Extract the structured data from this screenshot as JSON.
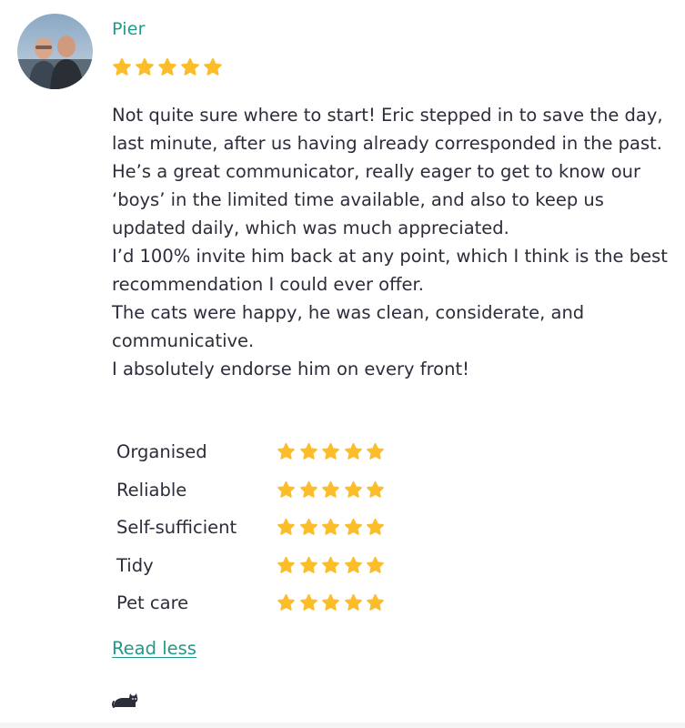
{
  "reviewer": {
    "name": "Pier",
    "overall_rating": 5,
    "max_rating": 5
  },
  "review": {
    "paragraphs": [
      "Not quite sure where to start! Eric stepped in to save the day, last minute, after us having already corresponded in the past.",
      "He’s a great communicator, really eager to get to know our ‘boys’ in the limited time available, and also to keep us updated daily, which was much appreciated.",
      "I’d 100% invite him back at any point, which I think is the best recommendation I could ever offer.",
      "The cats were happy, he was clean, considerate, and communicative.",
      "I absolutely endorse him on every front!"
    ]
  },
  "ratings": [
    {
      "label": "Organised",
      "stars": 5
    },
    {
      "label": "Reliable",
      "stars": 5
    },
    {
      "label": "Self-sufficient",
      "stars": 5
    },
    {
      "label": "Tidy",
      "stars": 5
    },
    {
      "label": "Pet care",
      "stars": 5
    }
  ],
  "actions": {
    "read_less_label": "Read less"
  },
  "icons": {
    "star": "star-icon",
    "pet": "cat-icon"
  },
  "colors": {
    "accent": "#1f9a8a",
    "star": "#fbbd29",
    "text": "#2b2d3a"
  }
}
